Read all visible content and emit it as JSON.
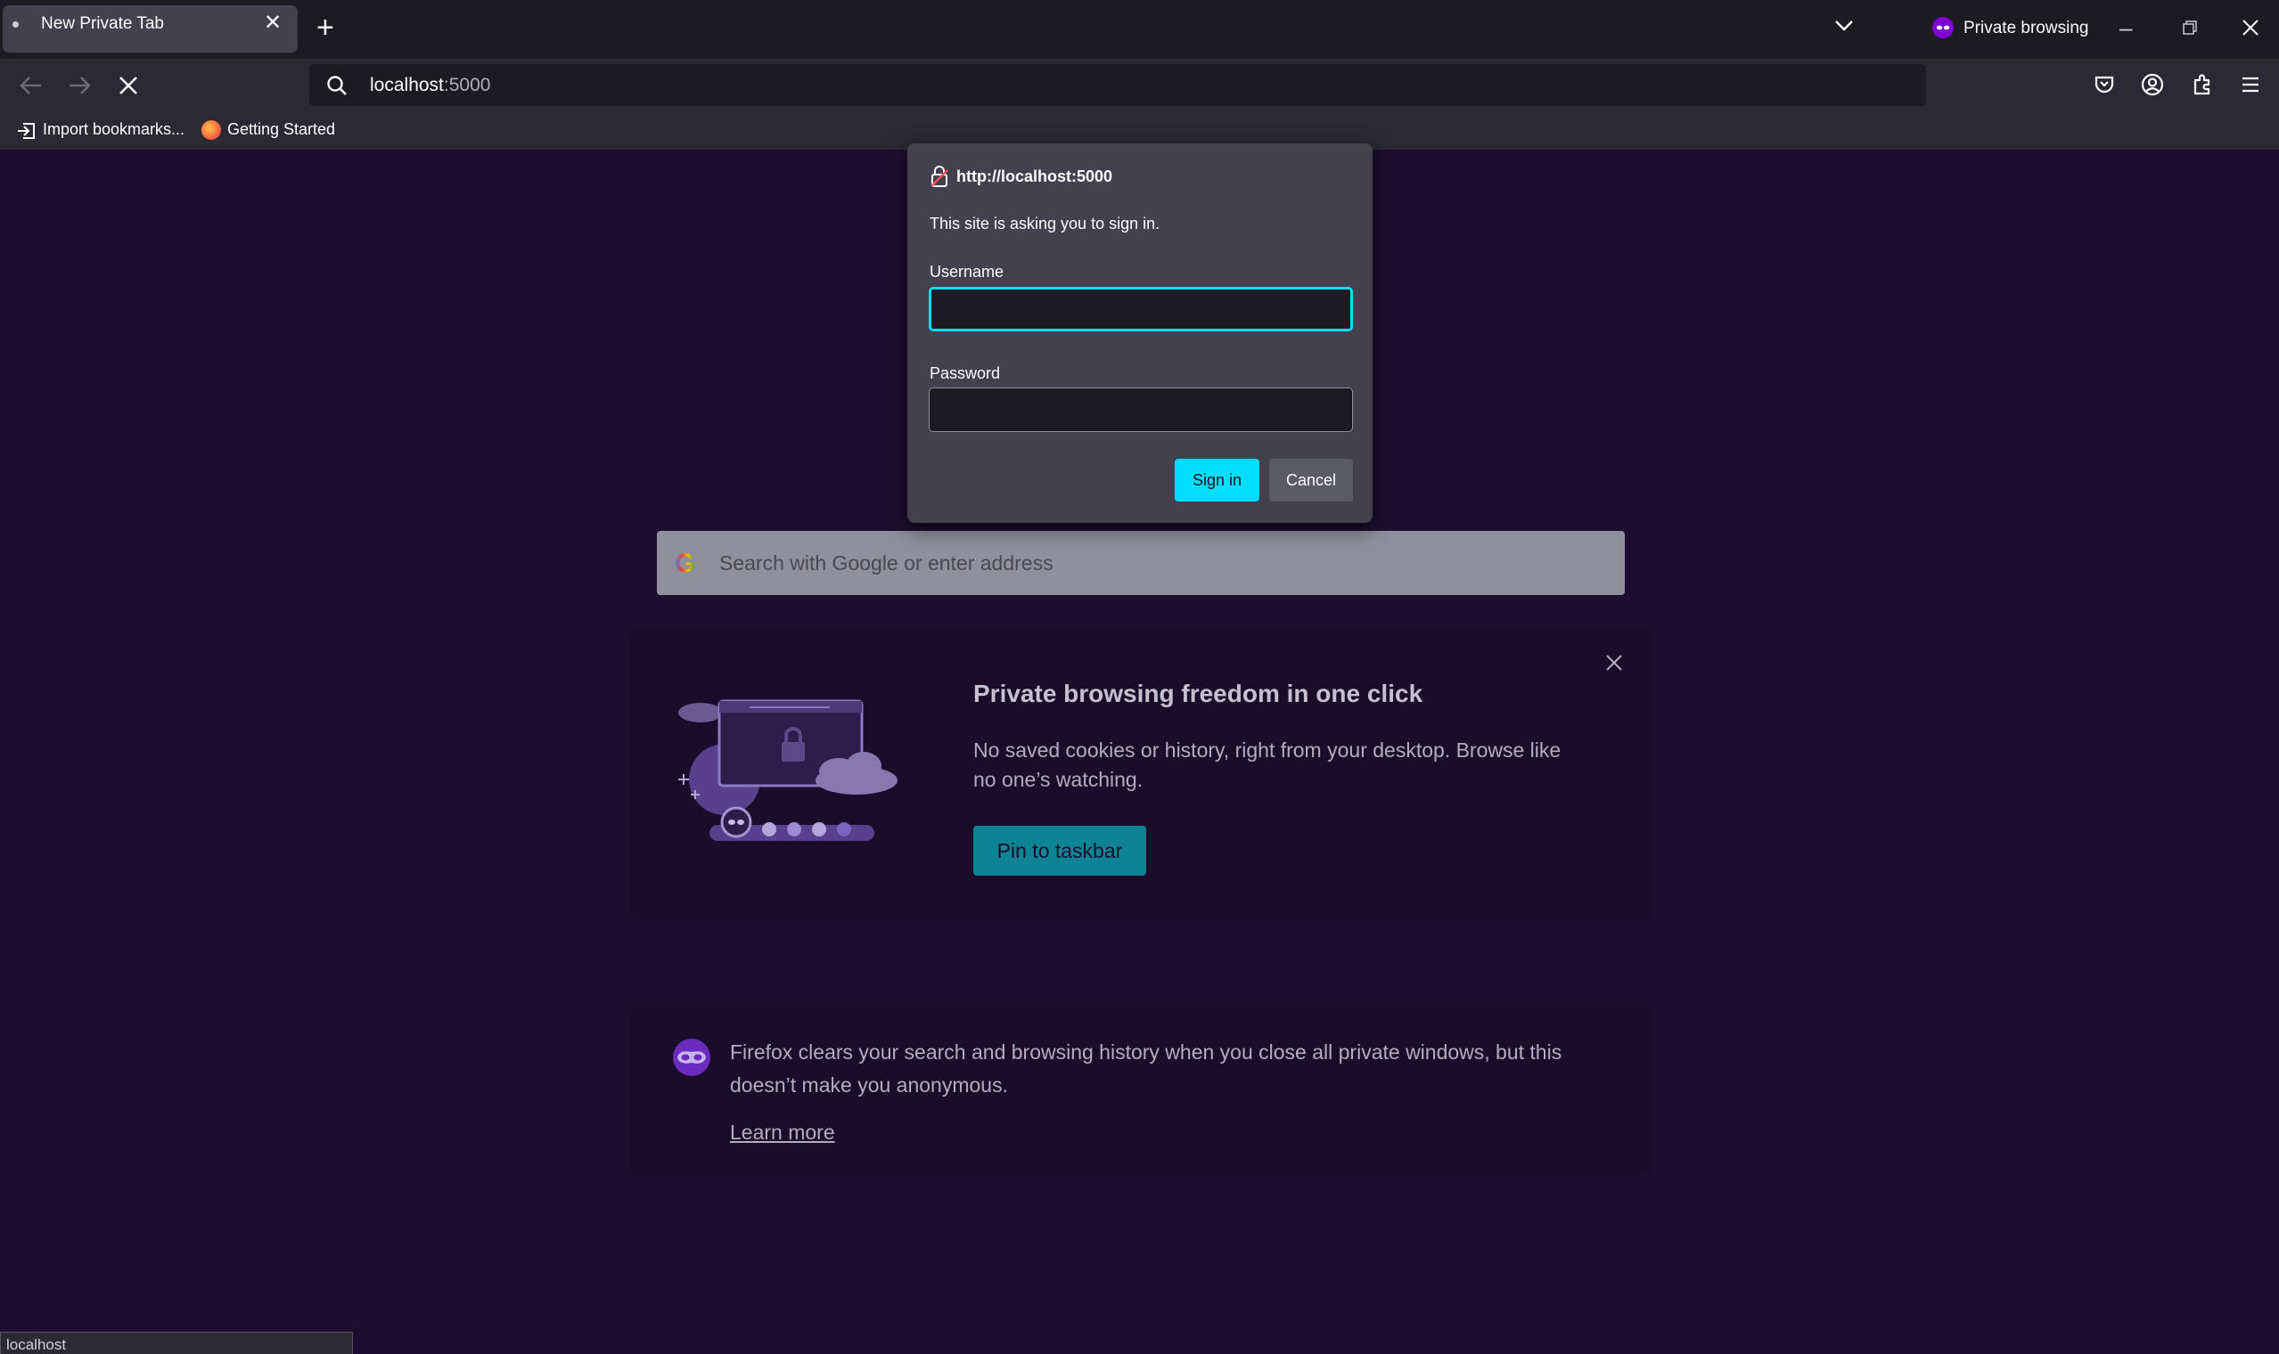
{
  "tab": {
    "title": "New Private Tab"
  },
  "window": {
    "private_label": "Private browsing"
  },
  "urlbar": {
    "host": "localhost",
    "port": ":5000"
  },
  "bookmarks": [
    {
      "label": "Import bookmarks..."
    },
    {
      "label": "Getting Started"
    }
  ],
  "dialog": {
    "host": "http://localhost:5000",
    "message": "This site is asking you to sign in.",
    "username_label": "Username",
    "username_value": "",
    "password_label": "Password",
    "password_value": "",
    "signin_label": "Sign in",
    "cancel_label": "Cancel"
  },
  "search": {
    "engine_icon": "G",
    "placeholder": "Search with Google or enter address"
  },
  "promo": {
    "title": "Private browsing freedom in one click",
    "body": "No saved cookies or history, right from your desktop. Browse like no one’s watching.",
    "button_label": "Pin to taskbar"
  },
  "info": {
    "text": "Firefox clears your search and browsing history when you close all private windows, but this doesn’t make you anonymous.",
    "link_label": "Learn more"
  },
  "status_bar": {
    "text": "localhost"
  },
  "colors": {
    "page_background": "#1c0f2e",
    "accent": "#00ddff",
    "private_purple": "#8000d7"
  }
}
